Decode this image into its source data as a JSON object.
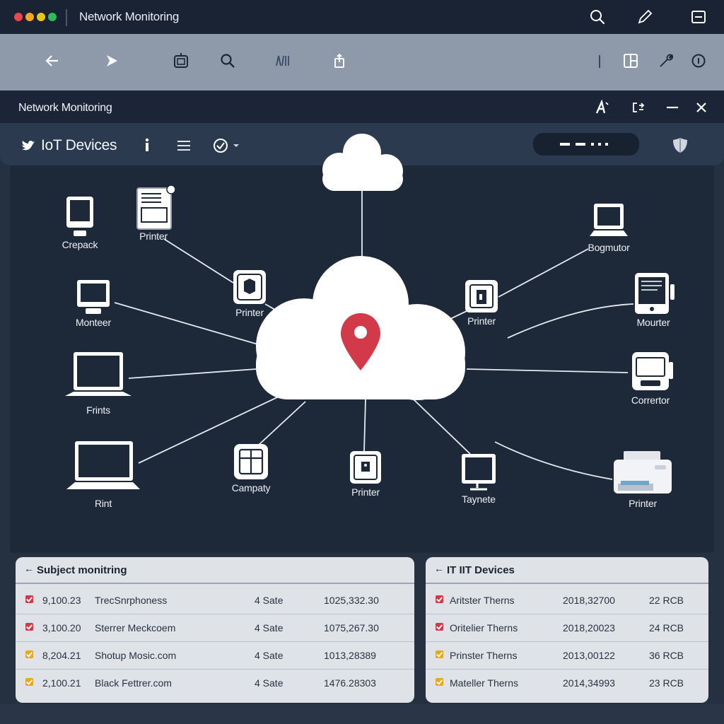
{
  "app": {
    "title": "Network Monitoring"
  },
  "window": {
    "title": "Network Monitoring"
  },
  "subbar": {
    "title": "IoT Devices"
  },
  "colors": {
    "accent": "#d23a4a",
    "warn": "#e6a91a"
  },
  "nodes": [
    {
      "label": "Crepack",
      "icon": "monitor-icon"
    },
    {
      "label": "Printer",
      "icon": "printer-icon"
    },
    {
      "label": "Printer",
      "icon": "device-icon"
    },
    {
      "label": "Monteer",
      "icon": "monitor-icon"
    },
    {
      "label": "Frints",
      "icon": "laptop-icon"
    },
    {
      "label": "Rint",
      "icon": "laptop-icon"
    },
    {
      "label": "Campaty",
      "icon": "device-icon"
    },
    {
      "label": "Printer",
      "icon": "device-icon"
    },
    {
      "label": "Taynete",
      "icon": "monitor-icon"
    },
    {
      "label": "Printer",
      "icon": "printer-icon"
    },
    {
      "label": "Bogmutor",
      "icon": "laptop-icon"
    },
    {
      "label": "Mourter",
      "icon": "tablet-icon"
    },
    {
      "label": "Printer",
      "icon": "device-icon"
    },
    {
      "label": "Corrertor",
      "icon": "printer-icon"
    }
  ],
  "panel_left": {
    "title": "Subject monitring",
    "rows": [
      {
        "id": "9,100.23",
        "name": "TrecSnrphoness",
        "state": "4 Sate",
        "value": "1025,332.30",
        "status": "red"
      },
      {
        "id": "3,100.20",
        "name": "Sterrer Meckcoem",
        "state": "4 Sate",
        "value": "1075,267.30",
        "status": "red"
      },
      {
        "id": "8,204.21",
        "name": "Shotup Mosic.com",
        "state": "4 Sate",
        "value": "1013,28389",
        "status": "yellow"
      },
      {
        "id": "2,100.21",
        "name": "Black Fettrer.com",
        "state": "4 Sate",
        "value": "1476.28303",
        "status": "yellow"
      }
    ]
  },
  "panel_right": {
    "title": "IT IIT Devices",
    "rows": [
      {
        "name": "Aritster Therns",
        "date": "2018,32700",
        "size": "22 RCB",
        "status": "red"
      },
      {
        "name": "Oritelier Therns",
        "date": "2018,20023",
        "size": "24 RCB",
        "status": "red"
      },
      {
        "name": "Prinster Therns",
        "date": "2013,00122",
        "size": "36 RCB",
        "status": "yellow"
      },
      {
        "name": "Mateller Therns",
        "date": "2014,34993",
        "size": "23 RCB",
        "status": "yellow"
      }
    ]
  }
}
